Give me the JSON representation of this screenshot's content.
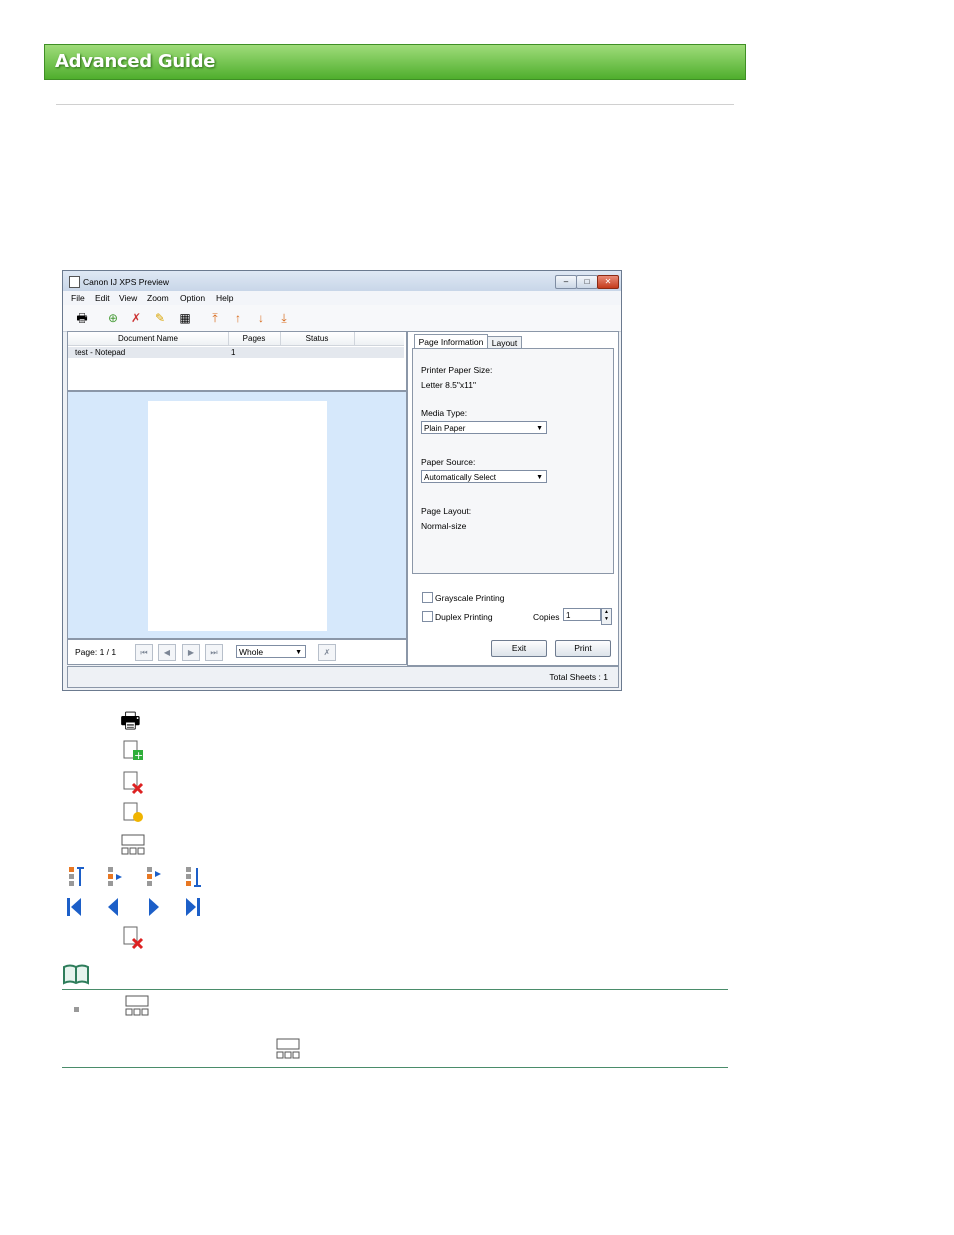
{
  "header": {
    "title": "Advanced Guide"
  },
  "window": {
    "title": "Canon IJ XPS Preview",
    "menu": [
      "File",
      "Edit",
      "View",
      "Zoom",
      "Option",
      "Help"
    ],
    "doc_list": {
      "columns": [
        "Document Name",
        "Pages",
        "Status"
      ],
      "rows": [
        {
          "name": "test - Notepad",
          "pages": "1",
          "status": ""
        }
      ]
    },
    "nav": {
      "page_label": "Page: 1 / 1",
      "zoom_value": "Whole"
    },
    "tabs": [
      "Page Information",
      "Layout"
    ],
    "page_info": {
      "printer_paper_size_label": "Printer Paper Size:",
      "printer_paper_size_value": "Letter 8.5\"x11\"",
      "media_type_label": "Media Type:",
      "media_type_value": "Plain Paper",
      "paper_source_label": "Paper Source:",
      "paper_source_value": "Automatically Select",
      "page_layout_label": "Page Layout:",
      "page_layout_value": "Normal-size"
    },
    "options": {
      "grayscale_label": "Grayscale Printing",
      "duplex_label": "Duplex Printing",
      "copies_label": "Copies",
      "copies_value": "1"
    },
    "buttons": {
      "exit": "Exit",
      "print": "Print"
    },
    "status": {
      "total_sheets": "Total Sheets :  1"
    }
  },
  "colors": {
    "banner_top": "#9fdc7a",
    "banner_bottom": "#4fae2d",
    "preview_bg": "#d6e8fb",
    "note_rule": "#4a8c6a"
  }
}
